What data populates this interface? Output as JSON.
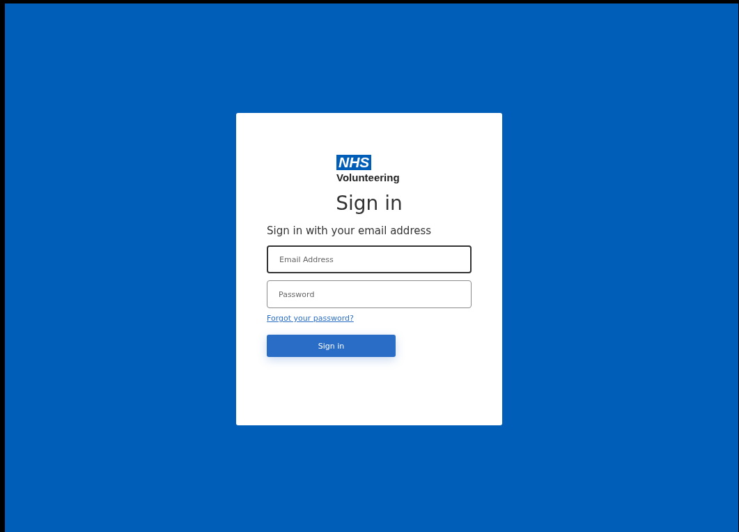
{
  "logo": {
    "badge": "NHS",
    "name": "Volunteering"
  },
  "title": "Sign in",
  "subtitle": "Sign in with your email address",
  "fields": [
    {
      "placeholder": "Email Address",
      "focused": true
    },
    {
      "placeholder": "Password",
      "focused": false
    }
  ],
  "forgot_link": "Forgot your password?",
  "submit_button": "Sign in"
}
